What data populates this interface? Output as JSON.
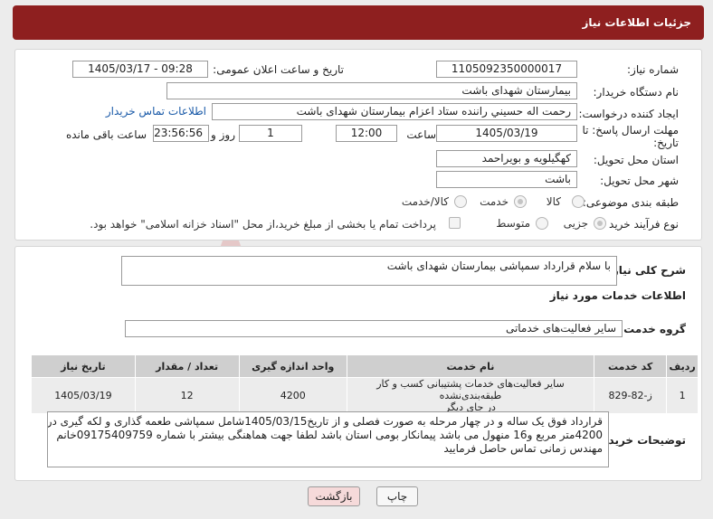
{
  "header": {
    "title": "جزئیات اطلاعات نیاز"
  },
  "fields": {
    "need_number_label": "شماره نیاز:",
    "need_number": "1105092350000017",
    "announce_label": "تاریخ و ساعت اعلان عمومی:",
    "announce_value": "1405/03/17 - 09:28",
    "buyer_label": "نام دستگاه خریدار:",
    "buyer_value": "بیمارستان شهدای باشت",
    "creator_label": "ایجاد کننده درخواست:",
    "creator_value": "رحمت اله حسيني راننده ستاد اعزام بیمارستان شهدای باشت",
    "buyer_contact_link": "اطلاعات تماس خریدار",
    "deadline_label_1": "مهلت ارسال پاسخ: تا",
    "deadline_label_2": "تاریخ:",
    "deadline_date": "1405/03/19",
    "time_label": "ساعت",
    "deadline_time": "12:00",
    "days_value": "1",
    "days_label": "روز و",
    "remaining_time": "23:56:56",
    "remaining_label": "ساعت باقی مانده",
    "province_label": "استان محل تحویل:",
    "province_value": "کهگیلویه و بویراحمد",
    "city_label": "شهر محل تحویل:",
    "city_value": "باشت",
    "category_label": "طبقه بندی موضوعی:",
    "category_options": [
      "کالا",
      "خدمت",
      "کالا/خدمت"
    ],
    "category_selected": "خدمت",
    "process_label": "نوع فرآیند خرید :",
    "process_options": [
      "جزیی",
      "متوسط"
    ],
    "process_selected": "جزیی",
    "payment_note": "پرداخت تمام یا بخشی از مبلغ خرید،از محل \"اسناد خزانه اسلامی\" خواهد بود."
  },
  "summary": {
    "label": "شرح کلی نیاز:",
    "value": "با سلام قرارداد سمپاشی بیمارستان شهدای باشت"
  },
  "services": {
    "section_title": "اطلاعات خدمات مورد نیاز",
    "group_label": "گروه خدمت:",
    "group_value": "سایر فعالیت‌های خدماتی",
    "columns": [
      "ردیف",
      "کد خدمت",
      "نام خدمت",
      "واحد اندازه گیری",
      "تعداد / مقدار",
      "تاریخ نیاز"
    ],
    "rows": [
      {
        "row": "1",
        "code": "ز-82-829",
        "name_line1": "سایر فعالیت‌های خدمات پشتیبانی کسب و کار طبقه‌بندی‌نشده",
        "name_line2": "در جای دیگر",
        "unit": "4200",
        "qty": "12",
        "date": "1405/03/19"
      }
    ]
  },
  "buyer_notes": {
    "label": "توضیحات خریدار:",
    "line1": "قرارداد فوق یک ساله و در چهار مرحله به صورت فصلی و از تاریخ1405/03/15شامل سمپاشی طعمه گذاری و لکه گیری در",
    "line2": "4200متر مربع و16 منهول می باشد پیمانکار بومی استان باشد لطفا جهت هماهنگی بیشتر با شماره 09175409759خانم",
    "line3": "مهندس زمانی تماس حاصل فرمایید"
  },
  "actions": {
    "print": "چاپ",
    "back": "بازگشت"
  },
  "watermark": {
    "text": "AriaTender.neT"
  },
  "colors": {
    "title_bar": "#8e1f1f",
    "link": "#1a5aa8",
    "back_button": "#f6dada"
  }
}
